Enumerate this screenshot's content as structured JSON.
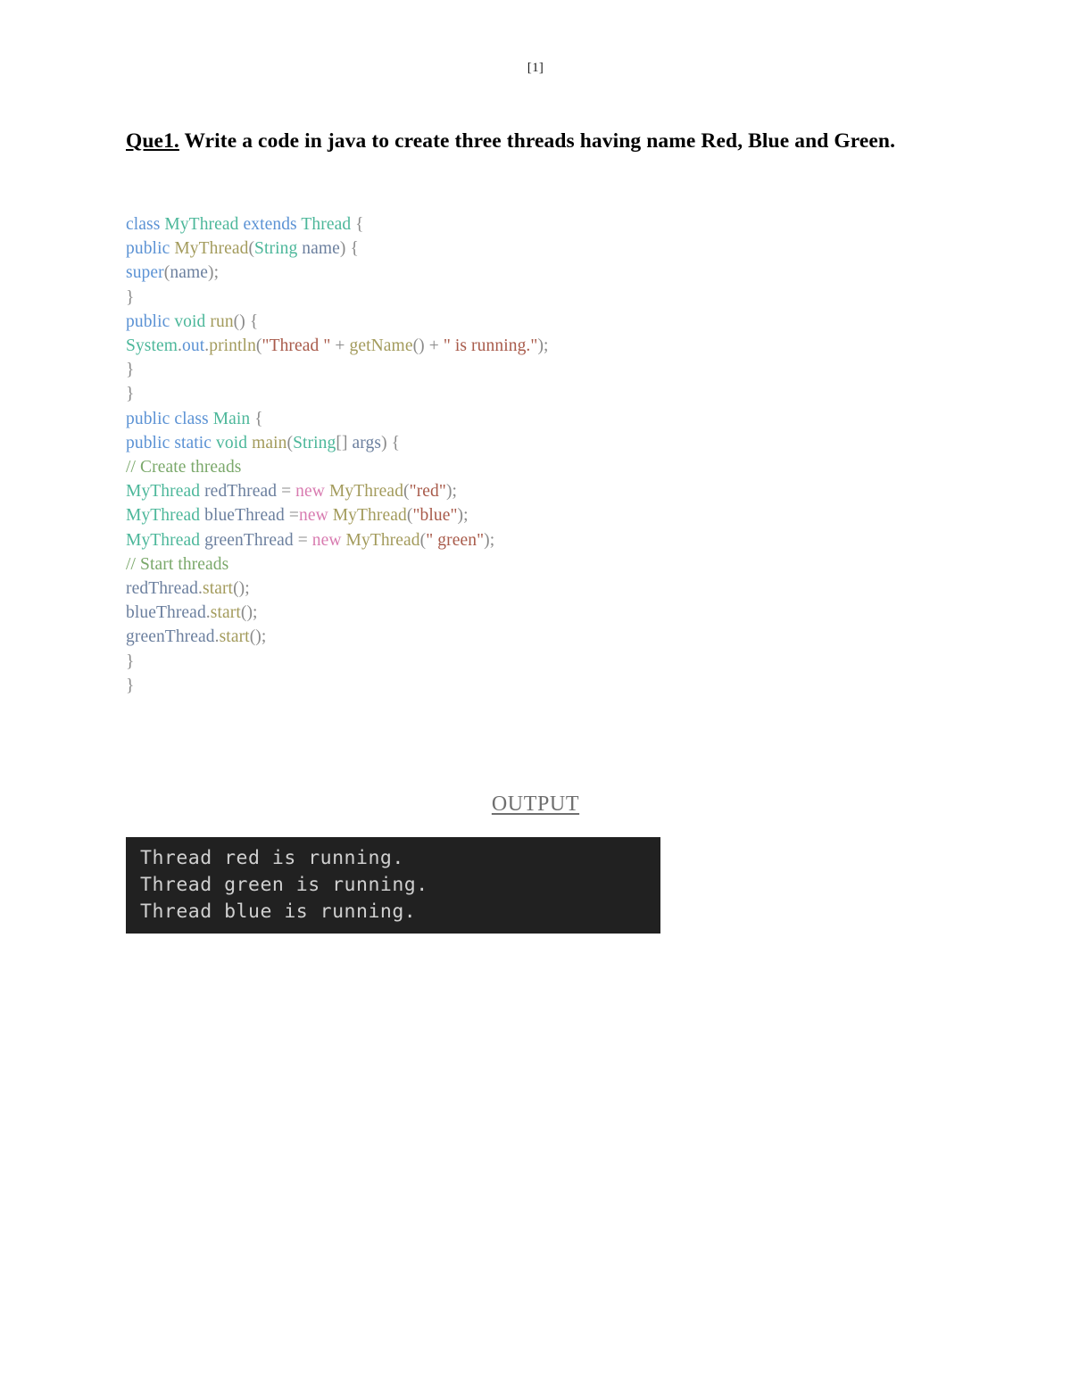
{
  "document": {
    "page_marker": "[1]"
  },
  "question": {
    "label": "Que1.",
    "text": " Write a code in java to create three threads having name Red, Blue and Green."
  },
  "code": {
    "language": "java",
    "lines": [
      [
        {
          "text": "class ",
          "token": "keyword"
        },
        {
          "text": "MyThread ",
          "token": "type"
        },
        {
          "text": "extends ",
          "token": "keyword"
        },
        {
          "text": "Thread ",
          "token": "type"
        },
        {
          "text": "{",
          "token": "punctuation"
        }
      ],
      [
        {
          "text": "public ",
          "token": "keyword"
        },
        {
          "text": "MyThread",
          "token": "method"
        },
        {
          "text": "(",
          "token": "punctuation"
        },
        {
          "text": "String ",
          "token": "type"
        },
        {
          "text": "name",
          "token": "variable"
        },
        {
          "text": ") {",
          "token": "punctuation"
        }
      ],
      [
        {
          "text": "super",
          "token": "keyword"
        },
        {
          "text": "(",
          "token": "punctuation"
        },
        {
          "text": "name",
          "token": "variable"
        },
        {
          "text": ");",
          "token": "punctuation"
        }
      ],
      [
        {
          "text": "}",
          "token": "punctuation"
        }
      ],
      [
        {
          "text": "public ",
          "token": "keyword"
        },
        {
          "text": "void ",
          "token": "type"
        },
        {
          "text": "run",
          "token": "method"
        },
        {
          "text": "() {",
          "token": "punctuation"
        }
      ],
      [
        {
          "text": "System",
          "token": "type"
        },
        {
          "text": ".",
          "token": "punctuation"
        },
        {
          "text": "out",
          "token": "keyword"
        },
        {
          "text": ".",
          "token": "punctuation"
        },
        {
          "text": "println",
          "token": "method"
        },
        {
          "text": "(",
          "token": "punctuation"
        },
        {
          "text": "\"Thread \"",
          "token": "string"
        },
        {
          "text": " + ",
          "token": "punctuation"
        },
        {
          "text": "getName",
          "token": "method"
        },
        {
          "text": "()",
          "token": "punctuation"
        },
        {
          "text": " + ",
          "token": "punctuation"
        },
        {
          "text": "\" is running.\"",
          "token": "string"
        },
        {
          "text": ");",
          "token": "punctuation"
        }
      ],
      [
        {
          "text": "}",
          "token": "punctuation"
        }
      ],
      [
        {
          "text": "}",
          "token": "punctuation"
        }
      ],
      [
        {
          "text": "public class ",
          "token": "keyword"
        },
        {
          "text": "Main ",
          "token": "type"
        },
        {
          "text": "{",
          "token": "punctuation"
        }
      ],
      [
        {
          "text": "public static ",
          "token": "keyword"
        },
        {
          "text": "void ",
          "token": "type"
        },
        {
          "text": "main",
          "token": "method"
        },
        {
          "text": "(",
          "token": "punctuation"
        },
        {
          "text": "String",
          "token": "type"
        },
        {
          "text": "[] ",
          "token": "punctuation"
        },
        {
          "text": "args",
          "token": "variable"
        },
        {
          "text": ") {",
          "token": "punctuation"
        }
      ],
      [
        {
          "text": "// Create threads",
          "token": "comment"
        }
      ],
      [
        {
          "text": "MyThread ",
          "token": "type"
        },
        {
          "text": "redThread ",
          "token": "variable"
        },
        {
          "text": "= ",
          "token": "punctuation"
        },
        {
          "text": "new ",
          "token": "new"
        },
        {
          "text": "MyThread",
          "token": "method"
        },
        {
          "text": "(",
          "token": "punctuation"
        },
        {
          "text": "\"red\"",
          "token": "string"
        },
        {
          "text": ");",
          "token": "punctuation"
        }
      ],
      [
        {
          "text": "MyThread ",
          "token": "type"
        },
        {
          "text": "blueThread ",
          "token": "variable"
        },
        {
          "text": "=",
          "token": "punctuation"
        },
        {
          "text": "new ",
          "token": "new"
        },
        {
          "text": "MyThread",
          "token": "method"
        },
        {
          "text": "(",
          "token": "punctuation"
        },
        {
          "text": "\"blue\"",
          "token": "string"
        },
        {
          "text": ");",
          "token": "punctuation"
        }
      ],
      [
        {
          "text": "MyThread ",
          "token": "type"
        },
        {
          "text": "greenThread ",
          "token": "variable"
        },
        {
          "text": "= ",
          "token": "punctuation"
        },
        {
          "text": "new ",
          "token": "new"
        },
        {
          "text": "MyThread",
          "token": "method"
        },
        {
          "text": "(",
          "token": "punctuation"
        },
        {
          "text": "\" green\"",
          "token": "string"
        },
        {
          "text": ");",
          "token": "punctuation"
        }
      ],
      [
        {
          "text": "// Start threads",
          "token": "comment"
        }
      ],
      [
        {
          "text": "redThread",
          "token": "variable"
        },
        {
          "text": ".",
          "token": "punctuation"
        },
        {
          "text": "start",
          "token": "method"
        },
        {
          "text": "();",
          "token": "punctuation"
        }
      ],
      [
        {
          "text": "blueThread",
          "token": "variable"
        },
        {
          "text": ".",
          "token": "punctuation"
        },
        {
          "text": "start",
          "token": "method"
        },
        {
          "text": "();",
          "token": "punctuation"
        }
      ],
      [
        {
          "text": "greenThread",
          "token": "variable"
        },
        {
          "text": ".",
          "token": "punctuation"
        },
        {
          "text": "start",
          "token": "method"
        },
        {
          "text": "();",
          "token": "punctuation"
        }
      ],
      [
        {
          "text": "}",
          "token": "punctuation"
        }
      ],
      [
        {
          "text": "}",
          "token": "punctuation"
        }
      ]
    ]
  },
  "output": {
    "heading": "OUTPUT",
    "terminal_background": "#212121",
    "terminal_text_color": "#d0d0d0",
    "lines": [
      "Thread red is running.",
      "Thread green is running.",
      "Thread blue is running."
    ]
  },
  "colors": {
    "keyword": "#5b92d4",
    "type": "#4cb79a",
    "method": "#a39b5c",
    "new": "#d87bb0",
    "string": "#a85a4a",
    "comment": "#7aa86a",
    "variable": "#6b7f9e",
    "punctuation": "#8a8a8a",
    "heading_gray": "#6f6f6f"
  }
}
